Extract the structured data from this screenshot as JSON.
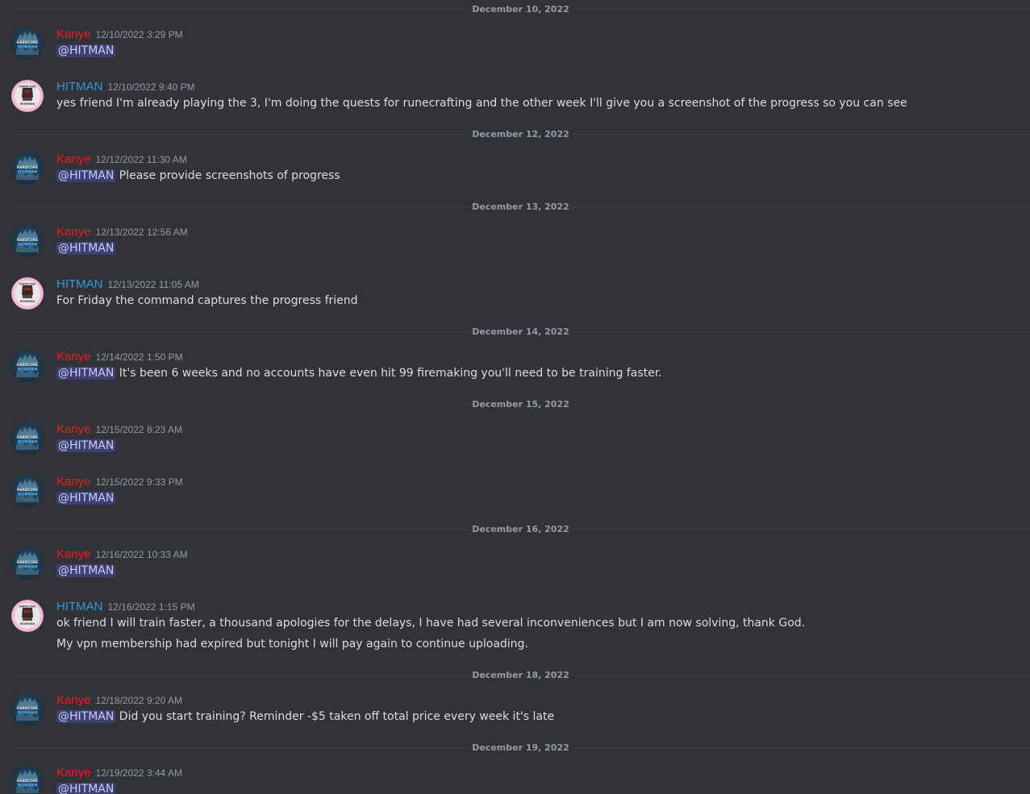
{
  "colors": {
    "background": "#313338",
    "kanye": "#ed1c24",
    "hitman": "#3498db",
    "mention_bg": "rgba(88,101,242,0.3)",
    "mention_text": "#c9cdfb",
    "text": "#dbdee1",
    "muted": "#949ba4"
  },
  "avatars": {
    "kanye": {
      "icon": "hardcore-ironman-avatar-icon",
      "text1": "HARDCORE",
      "text2": "IRONMAN"
    },
    "hitman": {
      "icon": "ironman-helmet-avatar-icon",
      "text1": "HARDCORE",
      "text2": "IRONMAN"
    }
  },
  "dates": [
    "December 10, 2022",
    "December 12, 2022",
    "December 13, 2022",
    "December 14, 2022",
    "December 15, 2022",
    "December 16, 2022",
    "December 18, 2022",
    "December 19, 2022"
  ],
  "messages": [
    {
      "author": "Kanye",
      "time": "12/10/2022 3:29 PM",
      "mention": "@HITMAN",
      "text": ""
    },
    {
      "author": "HITMAN",
      "time": "12/10/2022 9:40 PM",
      "text": "yes friend I'm already playing the 3, I'm doing the quests for runecrafting and the other week I'll give you a screenshot of the progress so you can see"
    },
    {
      "author": "Kanye",
      "time": "12/12/2022 11:30 AM",
      "mention": "@HITMAN",
      "text": " Please provide screenshots of progress"
    },
    {
      "author": "Kanye",
      "time": "12/13/2022 12:56 AM",
      "mention": "@HITMAN",
      "text": ""
    },
    {
      "author": "HITMAN",
      "time": "12/13/2022 11:05 AM",
      "text": "For Friday the command captures the progress friend"
    },
    {
      "author": "Kanye",
      "time": "12/14/2022 1:50 PM",
      "mention": "@HITMAN",
      "text": " It's been 6 weeks and no accounts have even hit 99 firemaking you'll need to be training faster."
    },
    {
      "author": "Kanye",
      "time": "12/15/2022 8:23 AM",
      "mention": "@HITMAN",
      "text": ""
    },
    {
      "author": "Kanye",
      "time": "12/15/2022 9:33 PM",
      "mention": "@HITMAN",
      "text": ""
    },
    {
      "author": "Kanye",
      "time": "12/16/2022 10:33 AM",
      "mention": "@HITMAN",
      "text": ""
    },
    {
      "author": "HITMAN",
      "time": "12/16/2022 1:15 PM",
      "text": "ok friend I will train faster, a thousand apologies for the delays, I have had several inconveniences but I am now solving, thank God.",
      "text2": "My vpn membership had expired but tonight I will pay again to continue uploading."
    },
    {
      "author": "Kanye",
      "time": "12/18/2022 9:20 AM",
      "mention": "@HITMAN",
      "text": " Did you start training? Reminder -$5 taken off total price every week it's late"
    },
    {
      "author": "Kanye",
      "time": "12/19/2022 3:44 AM",
      "mention": "@HITMAN",
      "text": ""
    }
  ]
}
